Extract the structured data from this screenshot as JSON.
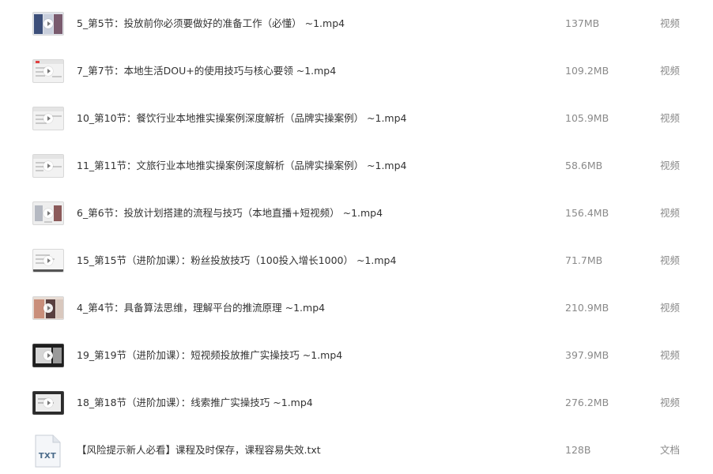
{
  "files": [
    {
      "name": "5_第5节：投放前你必须要做好的准备工作（必懂） ~1.mp4",
      "size": "137MB",
      "type": "视频",
      "icon": "video-thumbnail-icon",
      "thumb": "collage"
    },
    {
      "name": "7_第7节：本地生活DOU+的使用技巧与核心要领 ~1.mp4",
      "size": "109.2MB",
      "type": "视频",
      "icon": "video-thumbnail-icon",
      "thumb": "light"
    },
    {
      "name": "10_第10节：餐饮行业本地推实操案例深度解析（品牌实操案例） ~1.mp4",
      "size": "105.9MB",
      "type": "视频",
      "icon": "video-thumbnail-icon",
      "thumb": "light"
    },
    {
      "name": "11_第11节：文旅行业本地推实操案例深度解析（品牌实操案例） ~1.mp4",
      "size": "58.6MB",
      "type": "视频",
      "icon": "video-thumbnail-icon",
      "thumb": "light"
    },
    {
      "name": "6_第6节：投放计划搭建的流程与技巧（本地直播+短视频） ~1.mp4",
      "size": "156.4MB",
      "type": "视频",
      "icon": "video-thumbnail-icon",
      "thumb": "mixed"
    },
    {
      "name": "15_第15节（进阶加课）：粉丝投放技巧（100投入增长1000） ~1.mp4",
      "size": "71.7MB",
      "type": "视频",
      "icon": "video-thumbnail-icon",
      "thumb": "light"
    },
    {
      "name": "4_第4节：具备算法思维，理解平台的推流原理 ~1.mp4",
      "size": "210.9MB",
      "type": "视频",
      "icon": "video-thumbnail-icon",
      "thumb": "photo"
    },
    {
      "name": "19_第19节（进阶加课）：短视频投放推广实操技巧 ~1.mp4",
      "size": "397.9MB",
      "type": "视频",
      "icon": "video-thumbnail-icon",
      "thumb": "dark"
    },
    {
      "name": "18_第18节（进阶加课）：线索推广实操技巧 ~1.mp4",
      "size": "276.2MB",
      "type": "视频",
      "icon": "video-thumbnail-icon",
      "thumb": "darkframe"
    },
    {
      "name": "【风险提示新人必看】课程及时保存，课程容易失效.txt",
      "size": "128B",
      "type": "文档",
      "icon": "txt-file-icon",
      "thumb": "txt",
      "icon_label": "TXT"
    }
  ],
  "colors": {
    "name_text": "#333333",
    "meta_text": "#8a8a8a",
    "txt_icon_label": "#4a6b8a"
  }
}
